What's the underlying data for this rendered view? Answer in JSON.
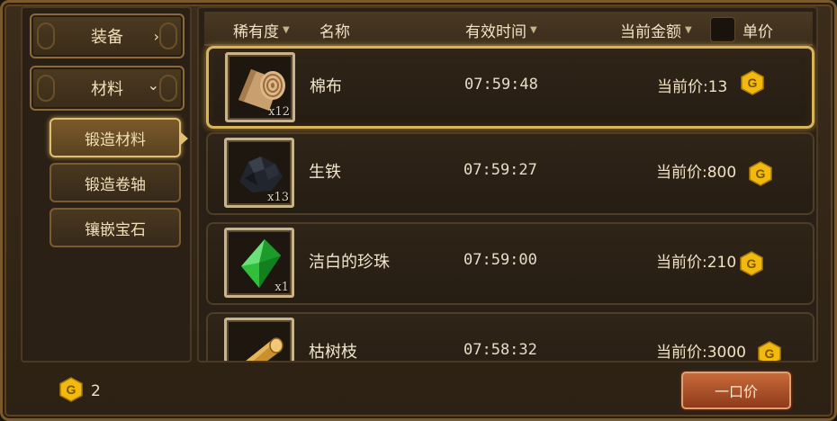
{
  "sidebar": {
    "categories": [
      {
        "label": "装备",
        "chevron": "›"
      },
      {
        "label": "材料",
        "chevron": "⌄"
      }
    ],
    "subitems": [
      {
        "label": "锻造材料",
        "active": true
      },
      {
        "label": "锻造卷轴",
        "active": false
      },
      {
        "label": "镶嵌宝石",
        "active": false
      }
    ]
  },
  "table": {
    "headers": {
      "rarity": "稀有度",
      "name": "名称",
      "time": "有效时间",
      "price": "当前金额",
      "unit_price": "单价"
    },
    "rows": [
      {
        "name": "棉布",
        "qty": "x12",
        "time": "07:59:48",
        "price": "当前价:13",
        "icon": "cloth-roll-icon",
        "selected": true
      },
      {
        "name": "生铁",
        "qty": "x13",
        "time": "07:59:27",
        "price": "当前价:800",
        "icon": "iron-ore-icon",
        "selected": false
      },
      {
        "name": "洁白的珍珠",
        "qty": "x1",
        "time": "07:59:00",
        "price": "当前价:210",
        "icon": "green-gem-icon",
        "selected": false
      },
      {
        "name": "枯树枝",
        "qty": "",
        "time": "07:58:32",
        "price": "当前价:3000",
        "icon": "wood-log-icon",
        "selected": false
      }
    ]
  },
  "footer": {
    "balance": "2",
    "buyout_label": "一口价"
  },
  "colors": {
    "gold": "#f2b90f",
    "selected_border": "#d8b45a",
    "buyout": "#b85a2e"
  }
}
